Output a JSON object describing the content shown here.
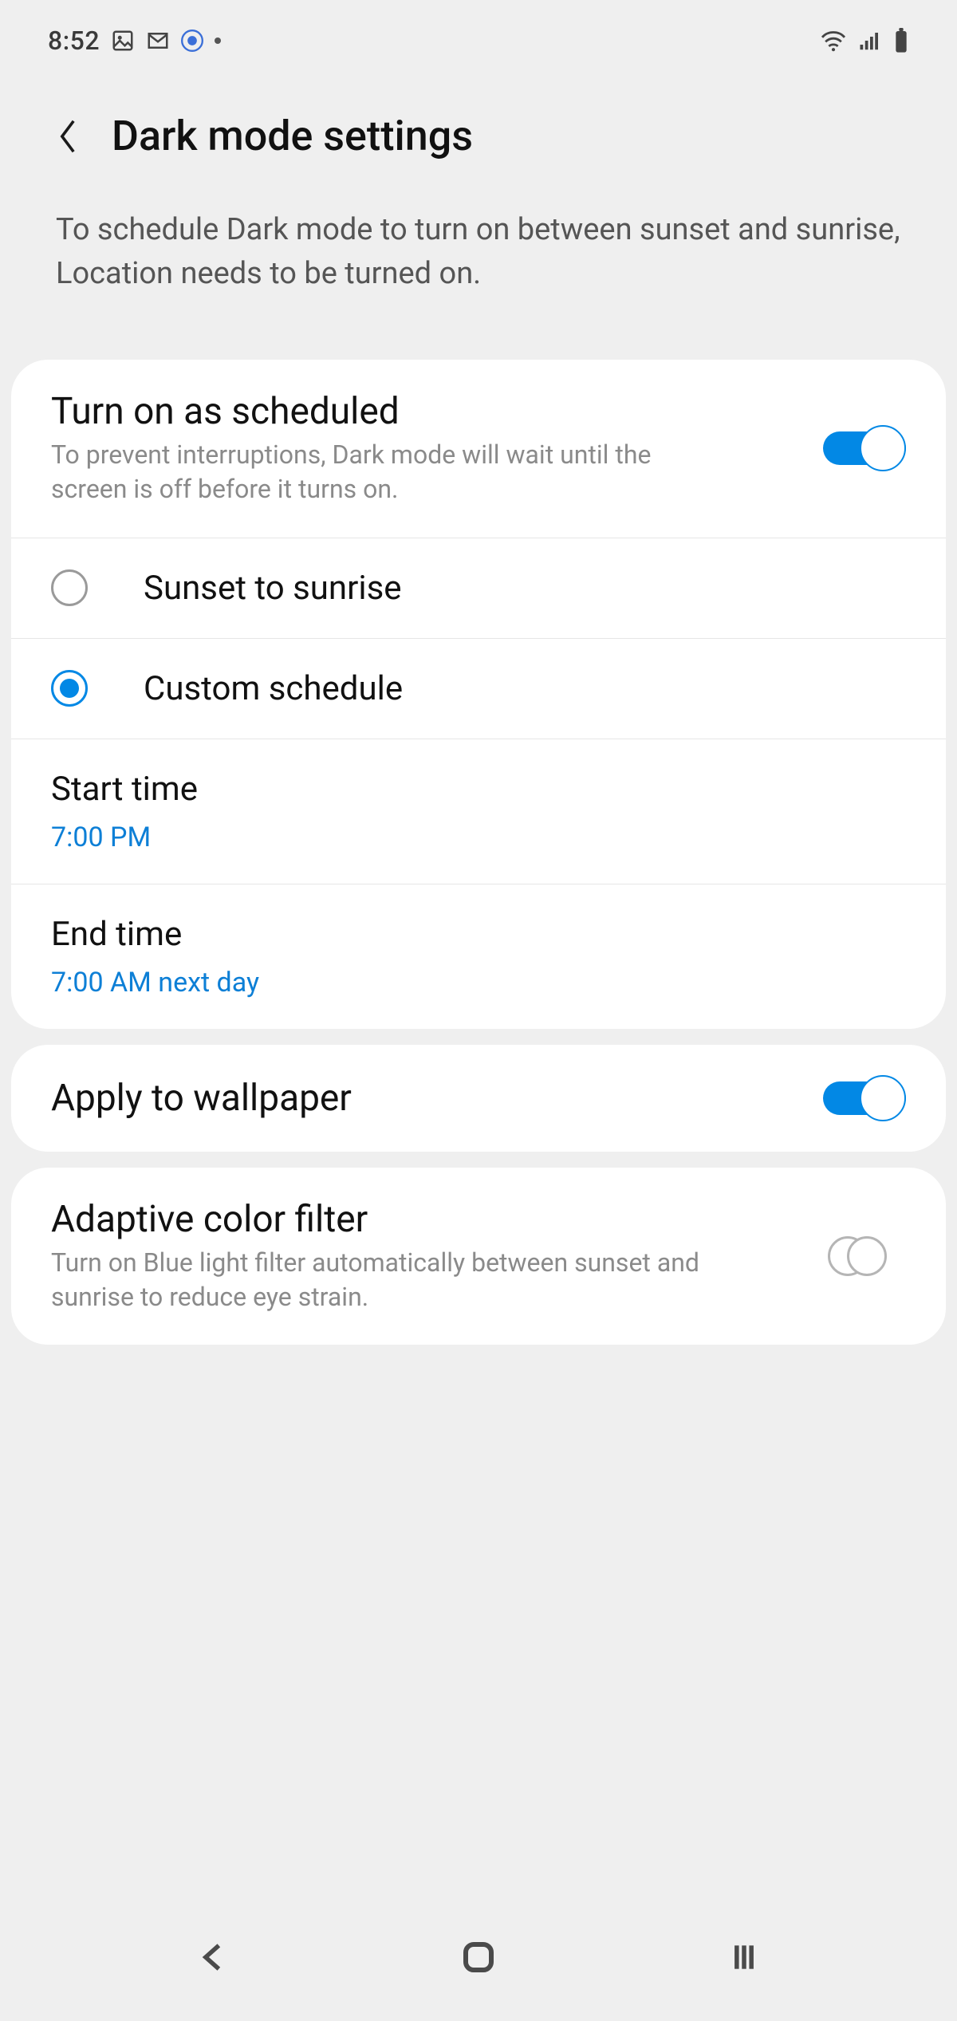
{
  "statusbar": {
    "time": "8:52",
    "icons_left": [
      "picture-icon",
      "mail-icon",
      "heart-circle-icon",
      "dot-icon"
    ],
    "icons_right": [
      "wifi-icon",
      "signal-icon",
      "battery-icon"
    ]
  },
  "header": {
    "title": "Dark mode settings"
  },
  "intro": {
    "text": "To schedule Dark mode to turn on between sunset and sunrise, Location needs to be turned on."
  },
  "schedule_card": {
    "toggle": {
      "title": "Turn on as scheduled",
      "subtitle": "To prevent interruptions, Dark mode will wait until the screen is off before it turns on.",
      "on": true
    },
    "options": [
      {
        "label": "Sunset to sunrise",
        "selected": false
      },
      {
        "label": "Custom schedule",
        "selected": true
      }
    ],
    "start": {
      "label": "Start time",
      "value": "7:00 PM"
    },
    "end": {
      "label": "End time",
      "value": "7:00 AM next day"
    }
  },
  "wallpaper_card": {
    "title": "Apply to wallpaper",
    "on": true
  },
  "adaptive_card": {
    "title": "Adaptive color filter",
    "subtitle": "Turn on Blue light filter automatically between sunset and sunrise to reduce eye strain.",
    "on": false
  },
  "colors": {
    "accent": "#0288e5",
    "link": "#0d7fd6",
    "text": "#111",
    "muted": "#8a8a8a",
    "bg": "#efefef",
    "card": "#ffffff"
  }
}
